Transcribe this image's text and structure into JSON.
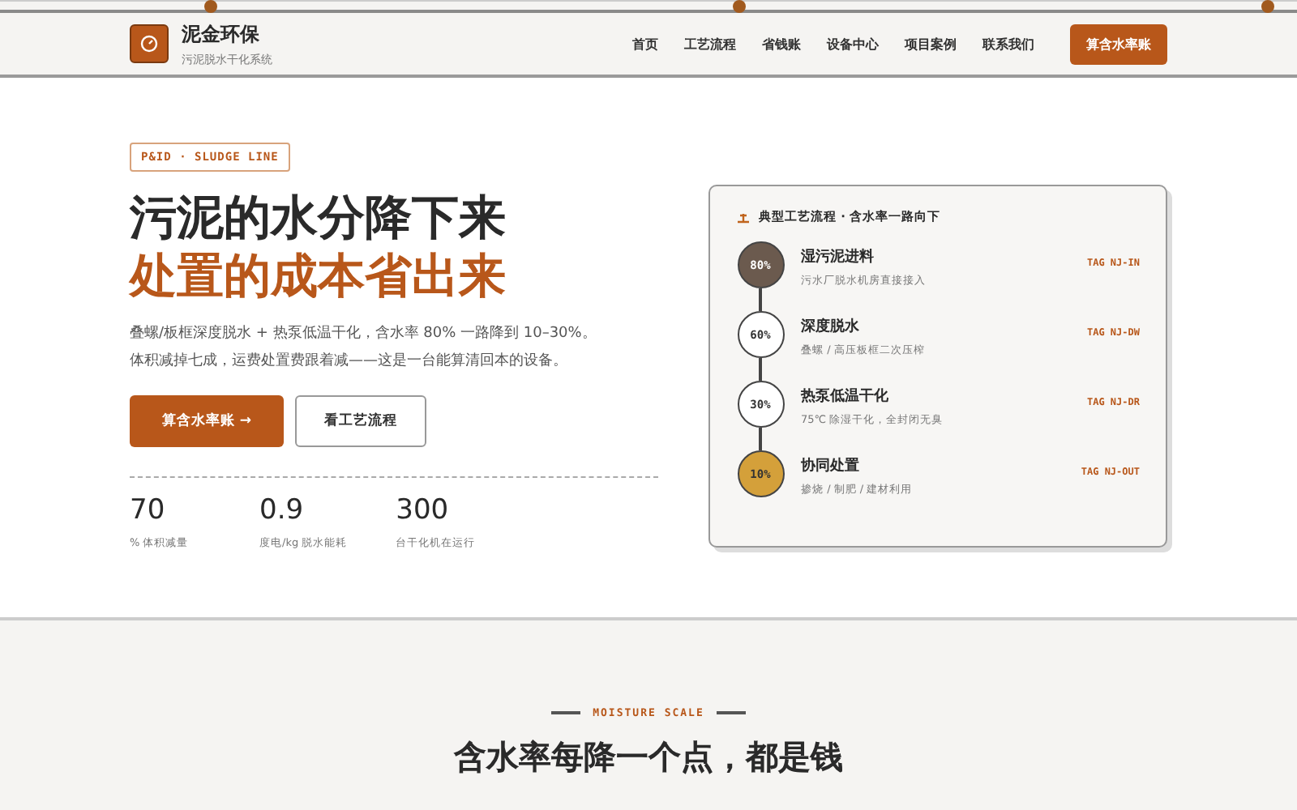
{
  "brand": {
    "name": "泥金环保",
    "tagline": "污泥脱水干化系统"
  },
  "nav": [
    "首页",
    "工艺流程",
    "省钱账",
    "设备中心",
    "项目案例",
    "联系我们"
  ],
  "nav_cta": "算含水率账",
  "hero": {
    "tag": "P&ID · SLUDGE LINE",
    "title_line1": "污泥的水分降下来",
    "title_line2": "处置的成本省出来",
    "desc": [
      "叠螺/板框深度脱水 + 热泵低温干化，含水率 80% 一路降到 10–30%。",
      "体积减掉七成，运费处置费跟着减——这是一台能算清回本的设备。"
    ],
    "primary_button": "算含水率账",
    "primary_arrow": "→",
    "secondary_button": "看工艺流程",
    "stats": [
      {
        "value": "70",
        "label": "% 体积减量"
      },
      {
        "value": "0.9",
        "label": "度电/kg 脱水能耗"
      },
      {
        "value": "300",
        "label": "台干化机在运行"
      }
    ]
  },
  "process_card": {
    "title": "典型工艺流程 · 含水率一路向下",
    "stages": [
      {
        "percent": "80%",
        "name": "湿污泥进料",
        "desc": "污水厂脱水机房直接接入",
        "tag": "TAG NJ-IN",
        "color": "#6b5a4e"
      },
      {
        "percent": "60%",
        "name": "深度脱水",
        "desc": "叠螺 / 高压板框二次压榨",
        "tag": "TAG NJ-DW",
        "color": "#ffffff"
      },
      {
        "percent": "30%",
        "name": "热泵低温干化",
        "desc": "75℃ 除湿干化，全封闭无臭",
        "tag": "TAG NJ-DR",
        "color": "#ffffff"
      },
      {
        "percent": "10%",
        "name": "协同处置",
        "desc": "掺烧 / 制肥 / 建材利用",
        "tag": "TAG NJ-OUT",
        "color": "#d4a03a"
      }
    ]
  },
  "moisture": {
    "eyebrow": "MOISTURE SCALE",
    "title": "含水率每降一个点，都是钱"
  }
}
